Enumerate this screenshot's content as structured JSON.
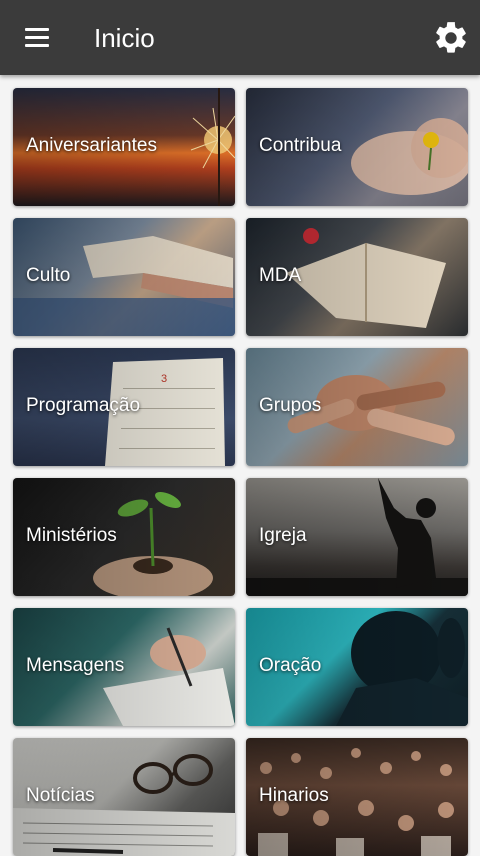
{
  "header": {
    "title": "Inicio",
    "menu_icon": "menu-icon",
    "settings_icon": "gear-icon",
    "background": "#3b3b3b"
  },
  "tiles": [
    {
      "label": "Aniversariantes"
    },
    {
      "label": "Contribua"
    },
    {
      "label": "Culto"
    },
    {
      "label": "MDA"
    },
    {
      "label": "Programação"
    },
    {
      "label": "Grupos"
    },
    {
      "label": "Ministérios"
    },
    {
      "label": "Igreja"
    },
    {
      "label": "Mensagens"
    },
    {
      "label": "Oração"
    },
    {
      "label": "Notícias"
    },
    {
      "label": "Hinarios"
    }
  ]
}
